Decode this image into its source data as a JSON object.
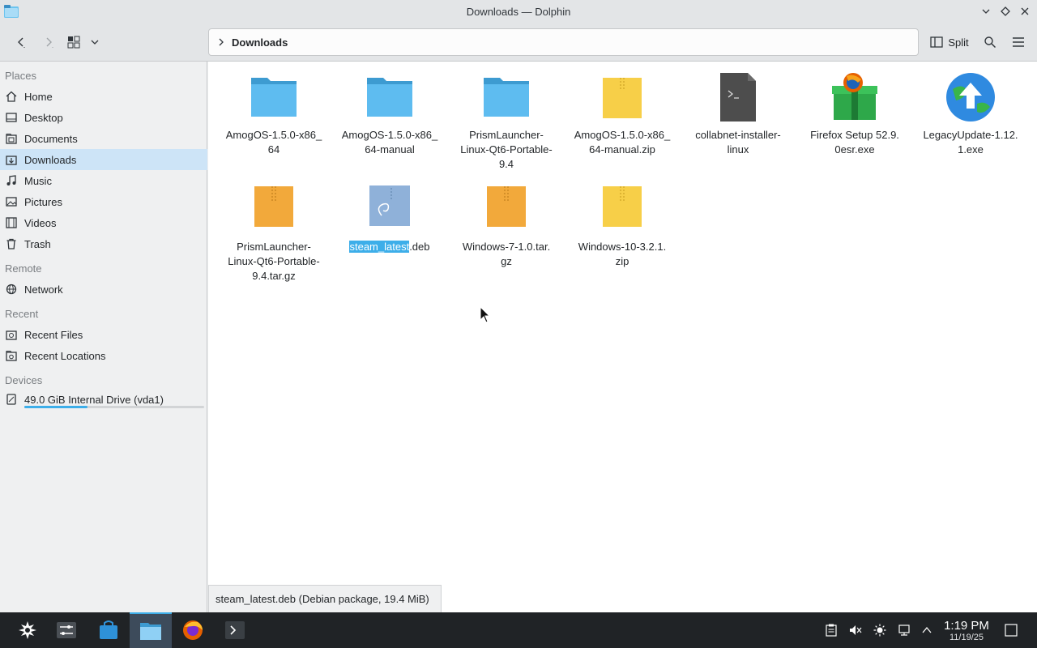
{
  "window": {
    "title": "Downloads — Dolphin"
  },
  "toolbar": {
    "breadcrumb": "Downloads",
    "split_label": "Split"
  },
  "sidebar": {
    "places_header": "Places",
    "places": [
      {
        "label": "Home",
        "icon": "home-icon"
      },
      {
        "label": "Desktop",
        "icon": "desktop-icon"
      },
      {
        "label": "Documents",
        "icon": "documents-icon"
      },
      {
        "label": "Downloads",
        "icon": "downloads-icon",
        "active": true
      },
      {
        "label": "Music",
        "icon": "music-icon"
      },
      {
        "label": "Pictures",
        "icon": "pictures-icon"
      },
      {
        "label": "Videos",
        "icon": "videos-icon"
      },
      {
        "label": "Trash",
        "icon": "trash-icon"
      }
    ],
    "remote_header": "Remote",
    "remote": [
      {
        "label": "Network",
        "icon": "network-icon"
      }
    ],
    "recent_header": "Recent",
    "recent": [
      {
        "label": "Recent Files",
        "icon": "recent-files-icon"
      },
      {
        "label": "Recent Locations",
        "icon": "recent-locations-icon"
      }
    ],
    "devices_header": "Devices",
    "devices": [
      {
        "label": "49.0 GiB Internal Drive (vda1)",
        "icon": "drive-icon",
        "usage_fraction": 0.35
      }
    ]
  },
  "files": [
    {
      "name": "AmogOS-1.5.0-x86_64",
      "line1": "AmogOS-1.5.0-x86_",
      "line2": "64",
      "line3": "",
      "type": "folder"
    },
    {
      "name": "AmogOS-1.5.0-x86_64-manual",
      "line1": "AmogOS-1.5.0-x86_",
      "line2": "64-manual",
      "line3": "",
      "type": "folder"
    },
    {
      "name": "PrismLauncher-Linux-Qt6-Portable-9.4",
      "line1": "PrismLauncher-",
      "line2": "Linux-Qt6-Portable-",
      "line3": "9.4",
      "type": "folder"
    },
    {
      "name": "AmogOS-1.5.0-x86_64-manual.zip",
      "line1": "AmogOS-1.5.0-x86_",
      "line2": "64-manual.zip",
      "line3": "",
      "type": "zip"
    },
    {
      "name": "collabnet-installer-linux",
      "line1": "collabnet-installer-",
      "line2": "linux",
      "line3": "",
      "type": "script"
    },
    {
      "name": "Firefox Setup 52.9.0esr.exe",
      "line1": "Firefox Setup 52.9.",
      "line2": "0esr.exe",
      "line3": "",
      "type": "exe-firefox"
    },
    {
      "name": "LegacyUpdate-1.12.1.exe",
      "line1": "LegacyUpdate-1.12.",
      "line2": "1.exe",
      "line3": "",
      "type": "exe-legacy"
    },
    {
      "name": "PrismLauncher-Linux-Qt6-Portable-9.4.tar.gz",
      "line1": "PrismLauncher-",
      "line2": "Linux-Qt6-Portable-",
      "line3": "9.4.tar.gz",
      "type": "targz"
    },
    {
      "name": "steam_latest.deb",
      "sel": "steam_latest",
      "rest": ".deb",
      "type": "deb"
    },
    {
      "name": "Windows-7-1.0.tar.gz",
      "line1": "Windows-7-1.0.tar.",
      "line2": "gz",
      "line3": "",
      "type": "targz"
    },
    {
      "name": "Windows-10-3.2.1.zip",
      "line1": "Windows-10-3.2.1.",
      "line2": "zip",
      "line3": "",
      "type": "zip"
    }
  ],
  "statusbar": {
    "text": "steam_latest.deb (Debian package, 19.4 MiB)"
  },
  "taskbar": {
    "clock_time": "1:19 PM",
    "clock_date": "11/19/25"
  },
  "colors": {
    "accent": "#3daee9",
    "selection": "#cde4f7",
    "folder": "#5ebcf0",
    "zip": "#f7cf48",
    "targz": "#f2a93b"
  }
}
